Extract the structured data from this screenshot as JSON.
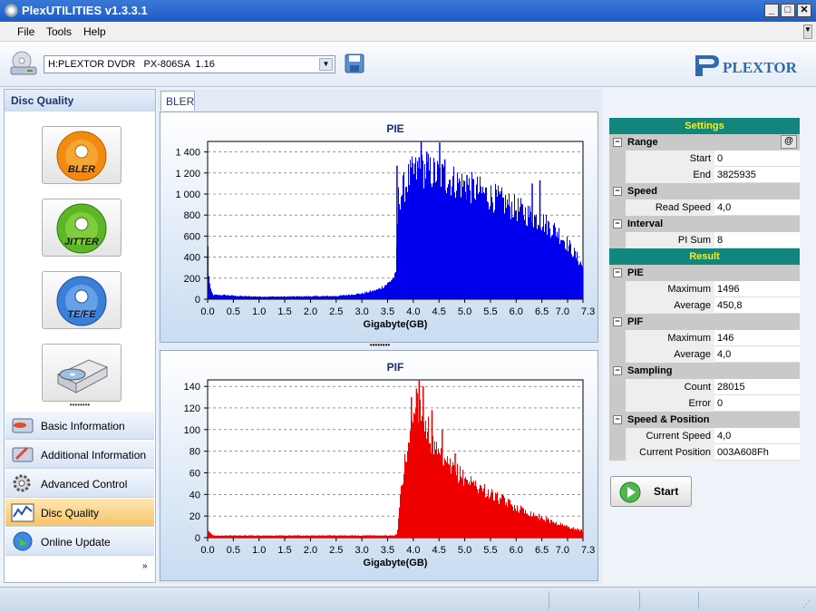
{
  "window": {
    "title": "PlexUTILITIES v1.3.3.1"
  },
  "menu": [
    "File",
    "Tools",
    "Help"
  ],
  "toolbar": {
    "drive": "H:PLEXTOR DVDR   PX-806SA  1.16",
    "logo": "PLEXTOR"
  },
  "sidebar": {
    "header": "Disc Quality",
    "tests": [
      {
        "label": "BLER"
      },
      {
        "label": "JITTER"
      },
      {
        "label": "TE/FE"
      },
      {
        "label": ""
      }
    ],
    "nav": [
      "Basic Information",
      "Additional Information",
      "Advanced Control",
      "Disc Quality",
      "Online Update"
    ],
    "active_nav": "Disc Quality"
  },
  "tab": {
    "label": "BLER"
  },
  "chart_data": [
    {
      "type": "area",
      "title": "PIE",
      "xlabel": "Gigabyte(GB)",
      "ylabel": "",
      "xlim": [
        0,
        7.3
      ],
      "ylim": [
        0,
        1500
      ],
      "x_ticks": [
        "0.0",
        "0.5",
        "1.0",
        "1.5",
        "2.0",
        "2.5",
        "3.0",
        "3.5",
        "4.0",
        "4.5",
        "5.0",
        "5.5",
        "6.0",
        "6.5",
        "7.0",
        "7.3"
      ],
      "y_ticks": [
        "0",
        "200",
        "400",
        "600",
        "800",
        "1 000",
        "1 200",
        "1 400"
      ],
      "color": "#0000ee",
      "x": [
        0.0,
        0.02,
        0.05,
        0.1,
        0.3,
        0.6,
        1.0,
        1.5,
        2.0,
        2.5,
        3.0,
        3.3,
        3.5,
        3.65,
        3.7,
        3.75,
        3.9,
        4.0,
        4.2,
        4.5,
        5.0,
        5.5,
        6.0,
        6.5,
        6.8,
        7.0,
        7.2,
        7.3
      ],
      "values": [
        480,
        200,
        90,
        40,
        40,
        30,
        25,
        25,
        28,
        30,
        55,
        90,
        150,
        230,
        950,
        1000,
        1150,
        1200,
        1230,
        1180,
        1080,
        980,
        860,
        740,
        640,
        520,
        380,
        300
      ],
      "spikes": [
        {
          "x": 3.67,
          "y": 1270
        },
        {
          "x": 4.02,
          "y": 1290
        },
        {
          "x": 4.1,
          "y": 1350
        },
        {
          "x": 4.14,
          "y": 1496
        },
        {
          "x": 4.25,
          "y": 1400
        },
        {
          "x": 4.5,
          "y": 1490
        },
        {
          "x": 4.6,
          "y": 1330
        },
        {
          "x": 5.03,
          "y": 1180
        },
        {
          "x": 6.3,
          "y": 1100
        },
        {
          "x": 6.45,
          "y": 1130
        }
      ]
    },
    {
      "type": "area",
      "title": "PIF",
      "xlabel": "Gigabyte(GB)",
      "ylabel": "",
      "xlim": [
        0,
        7.3
      ],
      "ylim": [
        0,
        146
      ],
      "x_ticks": [
        "0.0",
        "0.5",
        "1.0",
        "1.5",
        "2.0",
        "2.5",
        "3.0",
        "3.5",
        "4.0",
        "4.5",
        "5.0",
        "5.5",
        "6.0",
        "6.5",
        "7.0",
        "7.3"
      ],
      "y_ticks": [
        "0",
        "20",
        "40",
        "60",
        "80",
        "100",
        "120",
        "140"
      ],
      "color": "#ee0000",
      "x": [
        0.0,
        0.05,
        0.1,
        0.3,
        1.0,
        2.0,
        3.0,
        3.6,
        3.68,
        3.72,
        3.8,
        3.9,
        4.0,
        4.1,
        4.2,
        4.3,
        4.4,
        4.6,
        5.0,
        5.5,
        6.0,
        6.5,
        7.0,
        7.3
      ],
      "values": [
        6,
        4,
        2,
        2,
        2,
        2,
        2,
        2,
        3,
        30,
        60,
        90,
        115,
        125,
        112,
        95,
        80,
        68,
        55,
        40,
        28,
        18,
        10,
        6
      ],
      "spikes": [
        {
          "x": 3.95,
          "y": 130
        },
        {
          "x": 4.05,
          "y": 138
        },
        {
          "x": 4.1,
          "y": 146
        },
        {
          "x": 4.18,
          "y": 140
        },
        {
          "x": 4.35,
          "y": 118
        },
        {
          "x": 4.55,
          "y": 100
        },
        {
          "x": 4.8,
          "y": 78
        }
      ]
    }
  ],
  "settings": {
    "title": "Settings",
    "range": {
      "label": "Range",
      "start_label": "Start",
      "start": "0",
      "end_label": "End",
      "end": "3825935"
    },
    "speed": {
      "label": "Speed",
      "read_label": "Read Speed",
      "read": "4,0"
    },
    "interval": {
      "label": "Interval",
      "pisum_label": "PI Sum",
      "pisum": "8"
    }
  },
  "result": {
    "title": "Result",
    "pie": {
      "label": "PIE",
      "max_label": "Maximum",
      "max": "1496",
      "avg_label": "Average",
      "avg": "450,8"
    },
    "pif": {
      "label": "PIF",
      "max_label": "Maximum",
      "max": "146",
      "avg_label": "Average",
      "avg": "4,0"
    },
    "sampling": {
      "label": "Sampling",
      "count_label": "Count",
      "count": "28015",
      "error_label": "Error",
      "error": "0"
    },
    "speedpos": {
      "label": "Speed & Position",
      "cs_label": "Current Speed",
      "cs": "4,0",
      "cp_label": "Current Position",
      "cp": "003A608Fh"
    }
  },
  "start_button": "Start"
}
